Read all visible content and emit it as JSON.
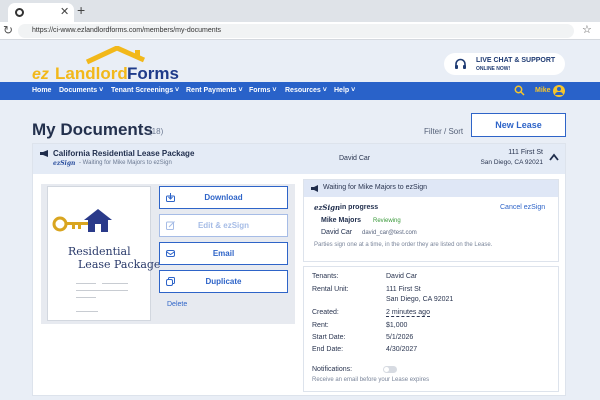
{
  "browser": {
    "url": "https://ci-www.ezlandlordforms.com/members/my-documents"
  },
  "header": {
    "logo_text_ez": "ez",
    "logo_text_landlord": "Landlord",
    "logo_text_forms": "Forms",
    "chat_title": "LIVE CHAT & SUPPORT",
    "chat_subtitle": "ONLINE NOW!"
  },
  "nav": {
    "items": [
      "Home",
      "Documents",
      "Tenant Screenings",
      "Rent Payments",
      "Forms",
      "Resources",
      "Help"
    ],
    "user_name": "Mike",
    "accent_color": "#2962c9",
    "user_color": "#f7c62a"
  },
  "page": {
    "title": "My Documents",
    "count": "(18)",
    "filter_sort": "Filter / Sort",
    "new_lease": "New Lease"
  },
  "document": {
    "title": "California Residential Lease Package",
    "ezsign_label": "ezSign",
    "status_line": "- Waiting for Mike Majors to ezSign",
    "tenant": "David Car",
    "address_line1": "111 First St",
    "address_line2": "San Diego, CA 92021",
    "thumbnail_title_1": "Residential",
    "thumbnail_title_2": "Lease Package"
  },
  "actions": {
    "download": "Download",
    "edit_ezsign": "Edit & ezSign",
    "email": "Email",
    "duplicate": "Duplicate",
    "delete": "Delete"
  },
  "ezsign_status": {
    "header": "Waiting for Mike Majors to ezSign",
    "logo": "ezSign",
    "status": "in progress",
    "cancel": "Cancel ezSign",
    "signer1_name": "Mike Majors",
    "signer1_status": "Reviewing",
    "signer2_name": "David Car",
    "signer2_email": "david_car@test.com",
    "note": "Parties sign one at a time, in the order they are listed on the Lease."
  },
  "details": {
    "tenants_label": "Tenants:",
    "tenants_value": "David Car",
    "unit_label": "Rental Unit:",
    "unit_value_1": "111 First St",
    "unit_value_2": "San Diego, CA 92021",
    "created_label": "Created:",
    "created_value": "2 minutes ago",
    "rent_label": "Rent:",
    "rent_value": "$1,000",
    "start_label": "Start Date:",
    "start_value": "5/1/2026",
    "end_label": "End Date:",
    "end_value": "4/30/2027",
    "notifications_label": "Notifications:",
    "notifications_note": "Receive an email before your Lease expires"
  }
}
